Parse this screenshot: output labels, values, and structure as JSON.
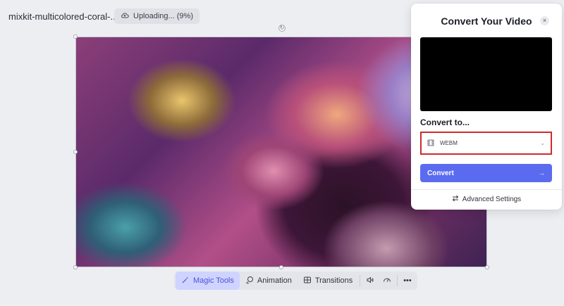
{
  "file": {
    "title": "mixkit-multicolored-coral-..."
  },
  "upload": {
    "status": "Uploading... (9%)",
    "progress": 0.09
  },
  "toolbar": {
    "magic_tools": "Magic Tools",
    "animation": "Animation",
    "transitions": "Transitions",
    "more": "•••"
  },
  "panel": {
    "title": "Convert Your Video",
    "close": "×",
    "convert_to_label": "Convert to...",
    "format_selected": "WEBM",
    "convert_button": "Convert",
    "advanced_settings": "Advanced Settings"
  },
  "colors": {
    "accent": "#5b6bf0",
    "highlight_border": "#d02a2a",
    "active_tool_bg": "#cfd3ff"
  },
  "icons": {
    "upload": "cloud-upload-icon",
    "magic": "wand-icon",
    "animation": "animation-icon",
    "transitions": "transitions-icon",
    "volume": "volume-icon",
    "speed": "speedometer-icon",
    "film": "film-icon",
    "sliders": "arrows-swap-icon"
  }
}
